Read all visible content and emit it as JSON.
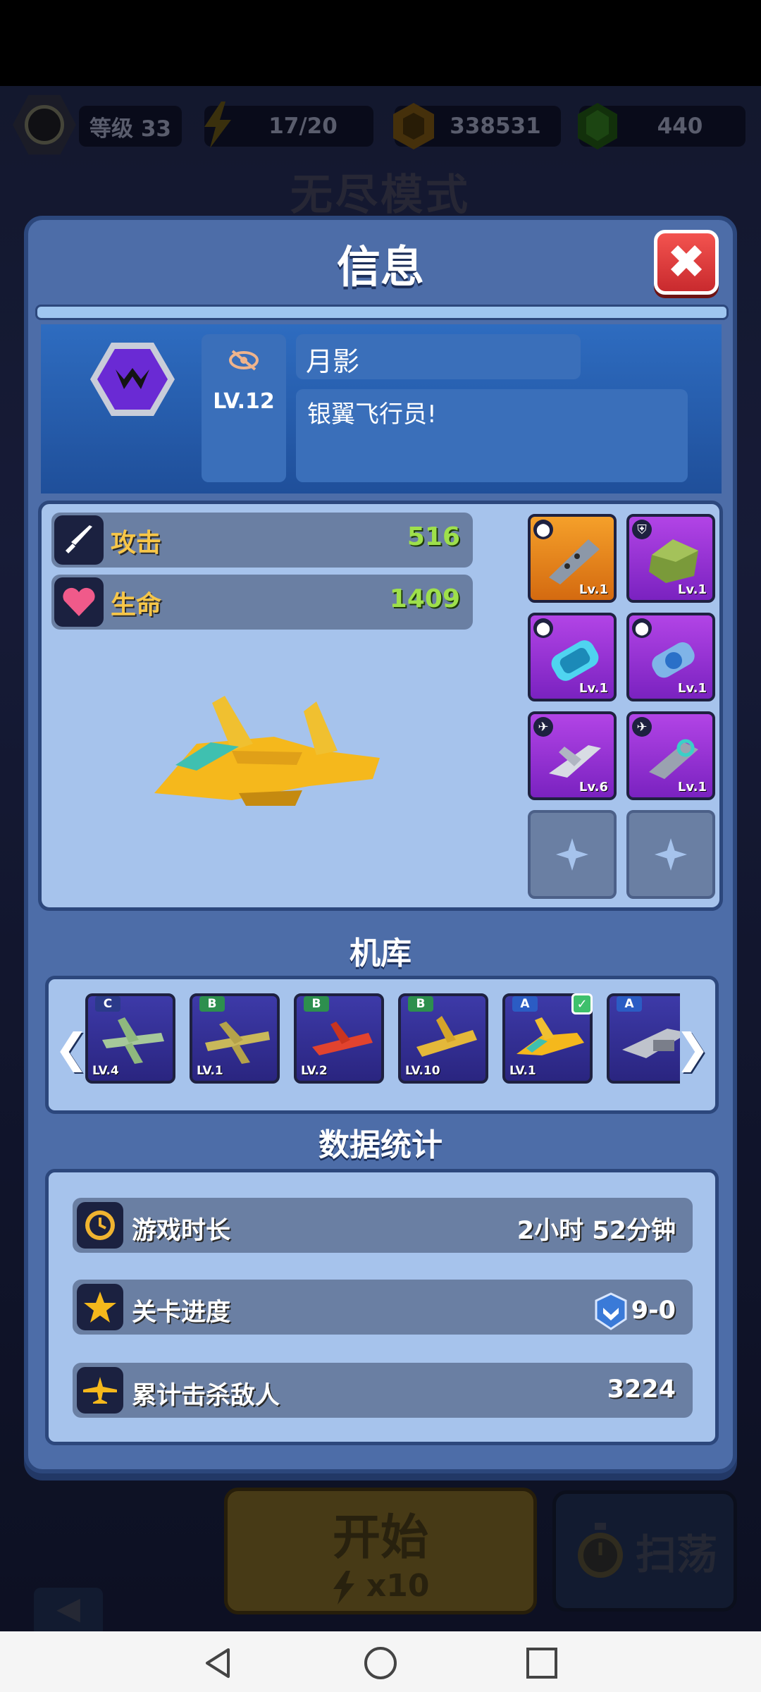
{
  "topbar": {
    "level_label": "等级 33",
    "energy": "17/20",
    "coins": "338531",
    "gems": "440"
  },
  "mode_title": "无尽模式",
  "panel": {
    "title": "信息",
    "close_glyph": "✖"
  },
  "profile": {
    "level": "LV.12",
    "name": "月影",
    "motto": "银翼飞行员!"
  },
  "stats": [
    {
      "label": "攻击",
      "value": "516",
      "icon": "sword-icon"
    },
    {
      "label": "生命",
      "value": "1409",
      "icon": "heart-icon"
    }
  ],
  "equipment": [
    {
      "lv": "Lv.1",
      "rarity": "orange",
      "type": "cannon"
    },
    {
      "lv": "Lv.1",
      "rarity": "purple",
      "type": "armor"
    },
    {
      "lv": "Lv.1",
      "rarity": "purple",
      "type": "energy-cell"
    },
    {
      "lv": "Lv.1",
      "rarity": "purple",
      "type": "capsule"
    },
    {
      "lv": "Lv.6",
      "rarity": "purple",
      "type": "wingman"
    },
    {
      "lv": "Lv.1",
      "rarity": "purple",
      "type": "wingman"
    }
  ],
  "hangar": {
    "title": "机库",
    "prev_glyph": "❮",
    "next_glyph": "❯",
    "planes": [
      {
        "grade": "C",
        "lv": "LV.4",
        "grade_color": "#2b3a8a"
      },
      {
        "grade": "B",
        "lv": "LV.1",
        "grade_color": "#2d8f4e"
      },
      {
        "grade": "B",
        "lv": "LV.2",
        "grade_color": "#2d8f4e"
      },
      {
        "grade": "B",
        "lv": "LV.10",
        "grade_color": "#2d8f4e"
      },
      {
        "grade": "A",
        "lv": "LV.1",
        "grade_color": "#2b5cc4",
        "selected": true
      },
      {
        "grade": "A",
        "lv": "",
        "grade_color": "#2b5cc4"
      }
    ]
  },
  "data_stats": {
    "title": "数据统计",
    "rows": [
      {
        "label": "游戏时长",
        "value": "2小时 52分钟",
        "icon": "clock-icon"
      },
      {
        "label": "关卡进度",
        "value": "9-0",
        "icon": "star-icon"
      },
      {
        "label": "累计击杀敌人",
        "value": "3224",
        "icon": "plane-icon"
      }
    ]
  },
  "bottom": {
    "start_label": "开始",
    "start_cost": "x10",
    "sweep_label": "扫荡"
  },
  "colors": {
    "panel": "#4d6da8",
    "attack_value": "#9ee04b",
    "close": "#e0403e"
  }
}
